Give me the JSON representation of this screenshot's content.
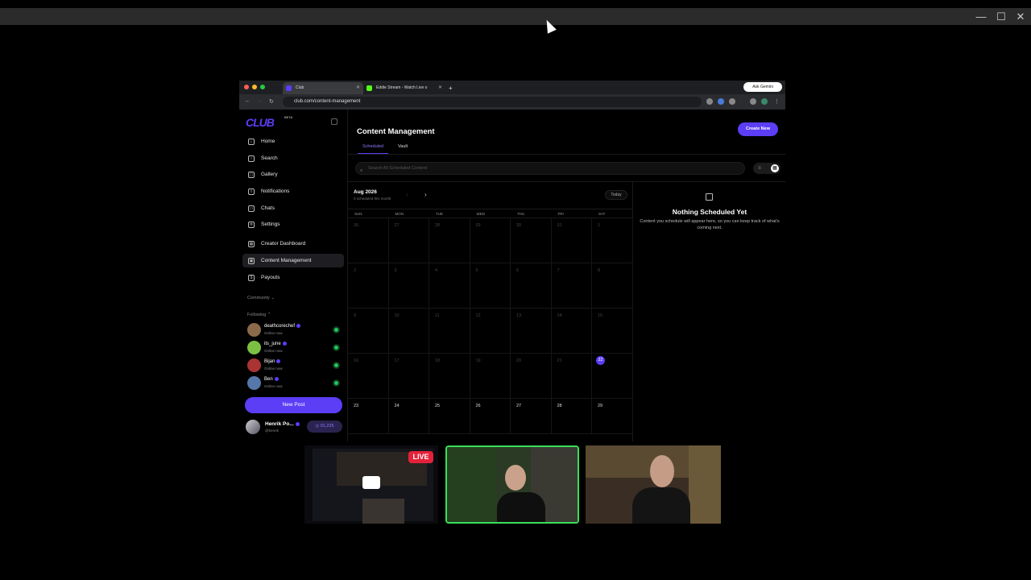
{
  "window": {
    "minimize": "—",
    "maximize": "☐",
    "close": "✕"
  },
  "browser": {
    "tabs": [
      {
        "title": "Club",
        "active": true
      },
      {
        "title": "Eddie Stream - Watch Live o",
        "active": false
      }
    ],
    "new_tab": "+",
    "ask_gemini": "Ask Gemini",
    "url": "club.com/content-management"
  },
  "sidebar": {
    "logo": "CLUB",
    "beta": "BETA",
    "items": [
      {
        "label": "Home",
        "icon": "home-icon",
        "glyph": "⌂"
      },
      {
        "label": "Search",
        "icon": "search-icon",
        "glyph": "○"
      },
      {
        "label": "Gallery",
        "icon": "gallery-icon",
        "glyph": "▢"
      },
      {
        "label": "Notifications",
        "icon": "bell-icon",
        "glyph": "◊"
      },
      {
        "label": "Chats",
        "icon": "chat-icon",
        "glyph": "▭"
      },
      {
        "label": "Settings",
        "icon": "gear-icon",
        "glyph": "✲"
      },
      {
        "label": "Creator Dashboard",
        "icon": "dashboard-icon",
        "glyph": "▦"
      },
      {
        "label": "Content Management",
        "icon": "content-icon",
        "glyph": "▣",
        "active": true
      },
      {
        "label": "Payouts",
        "icon": "dollar-icon",
        "glyph": "$"
      }
    ],
    "community_label": "Community",
    "following_label": "Following",
    "following": [
      {
        "name": "deathcorechef",
        "status": "Online now",
        "color": "#8a6a4a"
      },
      {
        "name": "its_june",
        "status": "Online now",
        "color": "#7bc043"
      },
      {
        "name": "Bijan",
        "status": "Online now",
        "color": "#a33"
      },
      {
        "name": "Ben",
        "status": "Online now",
        "color": "#5577aa"
      }
    ],
    "new_post": "New Post",
    "user": {
      "name": "Henrik Po...",
      "handle": "@henrik",
      "points": "91,225"
    }
  },
  "main": {
    "title": "Content Management",
    "create_new": "Create New",
    "tabs": [
      "Scheduled",
      "Vault"
    ],
    "search_placeholder": "Search All Scheduled Content",
    "calendar": {
      "month": "Aug 2026",
      "scheduled_count": "0 scheduled this month",
      "today_button": "Today",
      "weekdays": [
        "SUN",
        "MON",
        "TUE",
        "WED",
        "THU",
        "FRI",
        "SAT"
      ],
      "days": [
        "26",
        "27",
        "28",
        "29",
        "30",
        "31",
        "1",
        "2",
        "3",
        "4",
        "5",
        "6",
        "7",
        "8",
        "9",
        "10",
        "11",
        "12",
        "13",
        "14",
        "15",
        "16",
        "17",
        "18",
        "19",
        "20",
        "21",
        "22",
        "23",
        "24",
        "25",
        "26",
        "27",
        "28",
        "29"
      ],
      "current_day": "22"
    },
    "empty": {
      "title": "Nothing Scheduled Yet",
      "text": "Content you schedule will appear here, so you can keep track of what's coming next."
    }
  },
  "stream": {
    "live": "LIVE"
  },
  "colors": {
    "accent": "#5b3ef6",
    "live": "#e5213a",
    "online": "#22c55e"
  }
}
